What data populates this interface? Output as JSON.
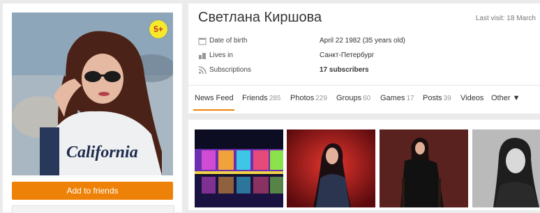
{
  "profile": {
    "age_badge": "5+",
    "add_friend_label": "Add to friends",
    "name": "Светлана Киршова",
    "last_visit": "Last visit: 18 March"
  },
  "info": [
    {
      "icon": "calendar-icon",
      "label": "Date of birth",
      "value": "April 22 1982 (35 years old)",
      "bold": false
    },
    {
      "icon": "location-icon",
      "label": "Lives in",
      "value": "Санкт-Петербург",
      "bold": false
    },
    {
      "icon": "rss-icon",
      "label": "Subscriptions",
      "value": "17 subscribers",
      "bold": true
    }
  ],
  "tabs": [
    {
      "label": "News Feed",
      "count": ""
    },
    {
      "label": "Friends",
      "count": "285"
    },
    {
      "label": "Photos",
      "count": "229"
    },
    {
      "label": "Groups",
      "count": "60"
    },
    {
      "label": "Games",
      "count": "17"
    },
    {
      "label": "Posts",
      "count": "39"
    },
    {
      "label": "Videos",
      "count": ""
    },
    {
      "label": "Other ▼",
      "count": ""
    }
  ],
  "colors": {
    "accent": "#ee8208",
    "badge": "#f6e82a"
  },
  "photos": [
    "photo-palace-night",
    "photo-red-backdrop",
    "photo-dark-studio",
    "photo-black-white"
  ]
}
